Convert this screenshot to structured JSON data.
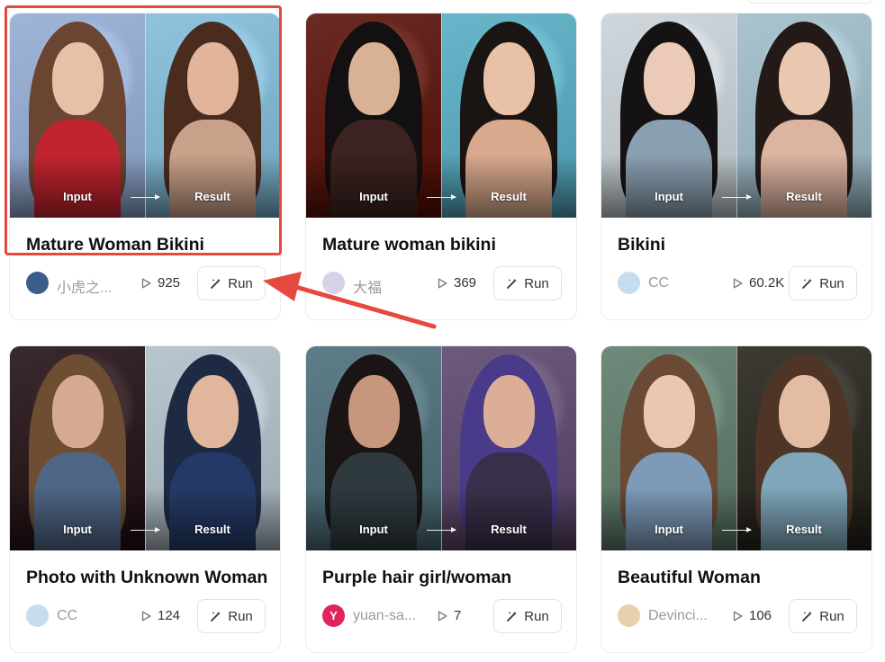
{
  "overlay": {
    "input_label": "Input",
    "result_label": "Result"
  },
  "button": {
    "run_label": "Run"
  },
  "cards": [
    {
      "title": "Mature Woman Bikini",
      "author": "小虎之...",
      "plays": "925",
      "avatar_letter": "",
      "colors": {
        "left_bg": "#9fb5d8",
        "left_face": "#e8c0a8",
        "left_hair": "#6a4532",
        "left_body": "#c2242f",
        "right_bg": "#8fc3dc",
        "right_face": "#e2b49a",
        "right_hair": "#4a2c1e",
        "right_body": "#c9a08a",
        "avatar": "#3b5d8a"
      }
    },
    {
      "title": "Mature woman bikini",
      "author": "大福",
      "plays": "369",
      "avatar_letter": "",
      "colors": {
        "left_bg": "#6b2a22",
        "left_face": "#d9b195",
        "left_hair": "#121010",
        "left_body": "#3c2220",
        "right_bg": "#69b5c9",
        "right_face": "#e8c1a6",
        "right_hair": "#1a1412",
        "right_body": "#d8a98c",
        "avatar": "#d8d2e8"
      }
    },
    {
      "title": "Bikini",
      "author": "CC",
      "plays": "60.2K",
      "avatar_letter": "",
      "colors": {
        "left_bg": "#cfd7dc",
        "left_face": "#eccab8",
        "left_hair": "#141212",
        "left_body": "#8a9fb0",
        "right_bg": "#a9c3cf",
        "right_face": "#eac7b1",
        "right_hair": "#231a17",
        "right_body": "#dcb49f",
        "avatar": "#c6dcef"
      }
    },
    {
      "title": "Photo with Unknown Woman",
      "author": "CC",
      "plays": "124",
      "avatar_letter": "",
      "colors": {
        "left_bg": "#3a2a2e",
        "left_face": "#d6a994",
        "left_hair": "#6e4e32",
        "left_body": "#4f6586",
        "right_bg": "#b8c6cf",
        "right_face": "#e0b69d",
        "right_hair": "#1e2a44",
        "right_body": "#243a66",
        "avatar": "#c6dcef"
      }
    },
    {
      "title": "Purple hair girl/woman",
      "author": "yuan-sa...",
      "plays": "7",
      "avatar_letter": "Y",
      "colors": {
        "left_bg": "#5f7d86",
        "left_face": "#c7977d",
        "left_hair": "#1a1514",
        "left_body": "#2f3a3e",
        "right_bg": "#6d5a7c",
        "right_face": "#dcae97",
        "right_hair": "#4a3a8a",
        "right_body": "#3a2f4a",
        "avatar": "#e0245e"
      }
    },
    {
      "title": "Beautiful Woman",
      "author": "Devinci...",
      "plays": "106",
      "avatar_letter": "",
      "colors": {
        "left_bg": "#6f8a7a",
        "left_face": "#eac7b0",
        "left_hair": "#6a4a34",
        "left_body": "#7d9ab8",
        "right_bg": "#3e3a34",
        "right_face": "#e4bca4",
        "right_hair": "#4e3526",
        "right_body": "#7fa6b9",
        "avatar": "#e8cfae"
      }
    }
  ]
}
